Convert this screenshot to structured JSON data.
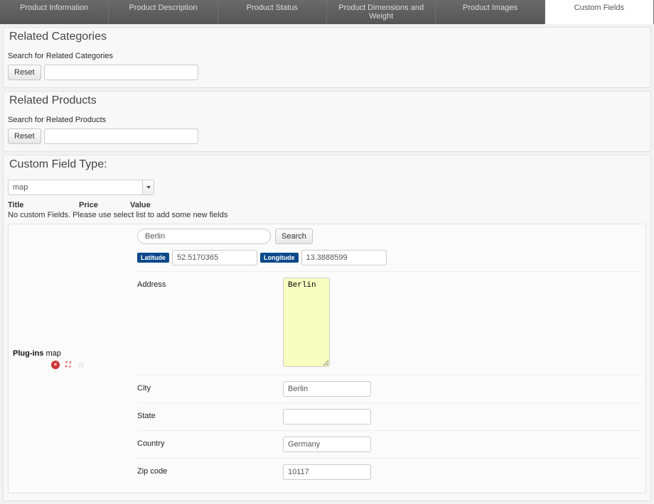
{
  "tabs": {
    "info": "Product Information",
    "desc": "Product Description",
    "status": "Product Status",
    "dim": "Product Dimensions and Weight",
    "images": "Product Images",
    "custom": "Custom Fields"
  },
  "relatedCategories": {
    "title": "Related Categories",
    "searchLabel": "Search for Related Categories",
    "resetLabel": "Reset",
    "searchValue": ""
  },
  "relatedProducts": {
    "title": "Related Products",
    "searchLabel": "Search for Related Products",
    "resetLabel": "Reset",
    "searchValue": ""
  },
  "customFieldType": {
    "title": "Custom Field Type:",
    "selectValue": "map",
    "headers": {
      "title": "Title",
      "price": "Price",
      "value": "Value"
    },
    "emptyMsg": "No custom Fields. Please use select list to add some new fields"
  },
  "mapForm": {
    "pluginLabelBold": "Plug-ins",
    "pluginLabelRest": " map",
    "searchValue": "Berlin",
    "searchButton": "Search",
    "latBadge": "Latitude",
    "latValue": "52.5170365",
    "lngBadge": "Longitude",
    "lngValue": "13.3888599",
    "fields": {
      "addressLabel": "Address",
      "addressValue": "Berlin",
      "cityLabel": "City",
      "cityValue": "Berlin",
      "stateLabel": "State",
      "stateValue": "",
      "countryLabel": "Country",
      "countryValue": "Germany",
      "zipLabel": "Zip code",
      "zipValue": "10117"
    }
  }
}
